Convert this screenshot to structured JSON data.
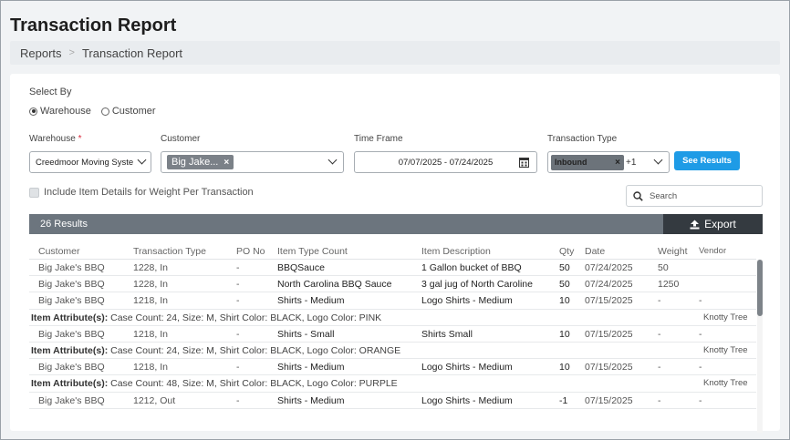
{
  "page": {
    "title": "Transaction Report"
  },
  "breadcrumb": {
    "root": "Reports",
    "current": "Transaction Report"
  },
  "filters": {
    "select_by_label": "Select By",
    "radio_options": [
      {
        "label": "Warehouse",
        "selected": true
      },
      {
        "label": "Customer",
        "selected": false
      }
    ],
    "warehouse": {
      "label": "Warehouse",
      "required_mark": "*",
      "value": "Creedmoor Moving Syste"
    },
    "customer": {
      "label": "Customer",
      "tag": "Big Jake..."
    },
    "time_frame": {
      "label": "Time Frame",
      "value": "07/07/2025 - 07/24/2025"
    },
    "transaction_type": {
      "label": "Transaction Type",
      "tag": "Inbound",
      "more": "+1"
    },
    "see_results_label": "See Results",
    "include_details_label": "Include Item Details for Weight Per Transaction",
    "search_placeholder": "Search"
  },
  "results": {
    "count_label": "26 Results",
    "export_label": "Export"
  },
  "table": {
    "headers": {
      "customer": "Customer",
      "transaction_type": "Transaction Type",
      "po_no": "PO No",
      "item_type_count": "Item Type Count",
      "item_description": "Item Description",
      "qty": "Qty",
      "date": "Date",
      "weight": "Weight",
      "vendor": "Vendor"
    },
    "rows": [
      {
        "kind": "row",
        "customer": "Big Jake's BBQ",
        "transaction_type": "1228, In",
        "po_no": "-",
        "item_type_count": "BBQSauce",
        "item_description": "1 Gallon bucket of BBQ",
        "qty": "50",
        "date": "07/24/2025",
        "weight": "50",
        "vendor": ""
      },
      {
        "kind": "row",
        "customer": "Big Jake's BBQ",
        "transaction_type": "1228, In",
        "po_no": "-",
        "item_type_count": "North Carolina BBQ Sauce",
        "item_description": "3 gal jug of North Caroline",
        "qty": "50",
        "date": "07/24/2025",
        "weight": "1250",
        "vendor": ""
      },
      {
        "kind": "row",
        "customer": "Big Jake's BBQ",
        "transaction_type": "1218, In",
        "po_no": "-",
        "item_type_count": "Shirts - Medium",
        "item_description": "Logo Shirts - Medium",
        "qty": "10",
        "date": "07/15/2025",
        "weight": "-",
        "vendor": "-"
      },
      {
        "kind": "attr",
        "label": "Item Attribute(s):",
        "text": " Case Count: 24, Size: M, Shirt Color: BLACK, Logo Color: PINK",
        "vendor": "Knotty Tree"
      },
      {
        "kind": "row",
        "customer": "Big Jake's BBQ",
        "transaction_type": "1218, In",
        "po_no": "-",
        "item_type_count": "Shirts - Small",
        "item_description": "Shirts Small",
        "qty": "10",
        "date": "07/15/2025",
        "weight": "-",
        "vendor": "-"
      },
      {
        "kind": "attr",
        "label": "Item Attribute(s):",
        "text": " Case Count: 24, Size: M, Shirt Color: BLACK, Logo Color: ORANGE",
        "vendor": "Knotty Tree"
      },
      {
        "kind": "row",
        "customer": "Big Jake's BBQ",
        "transaction_type": "1218, In",
        "po_no": "-",
        "item_type_count": "Shirts - Medium",
        "item_description": "Logo Shirts - Medium",
        "qty": "10",
        "date": "07/15/2025",
        "weight": "-",
        "vendor": "-"
      },
      {
        "kind": "attr",
        "label": "Item Attribute(s):",
        "text": " Case Count: 48, Size: M, Shirt Color: BLACK, Logo Color: PURPLE",
        "vendor": "Knotty Tree"
      },
      {
        "kind": "row",
        "customer": "Big Jake's BBQ",
        "transaction_type": "1212, Out",
        "po_no": "-",
        "item_type_count": "Shirts - Medium",
        "item_description": "Logo Shirts - Medium",
        "qty": "-1",
        "date": "07/15/2025",
        "weight": "-",
        "vendor": "-"
      }
    ]
  },
  "colors": {
    "accent": "#1e9be6",
    "results_bar": "#6c757e",
    "export": "#343a40"
  }
}
